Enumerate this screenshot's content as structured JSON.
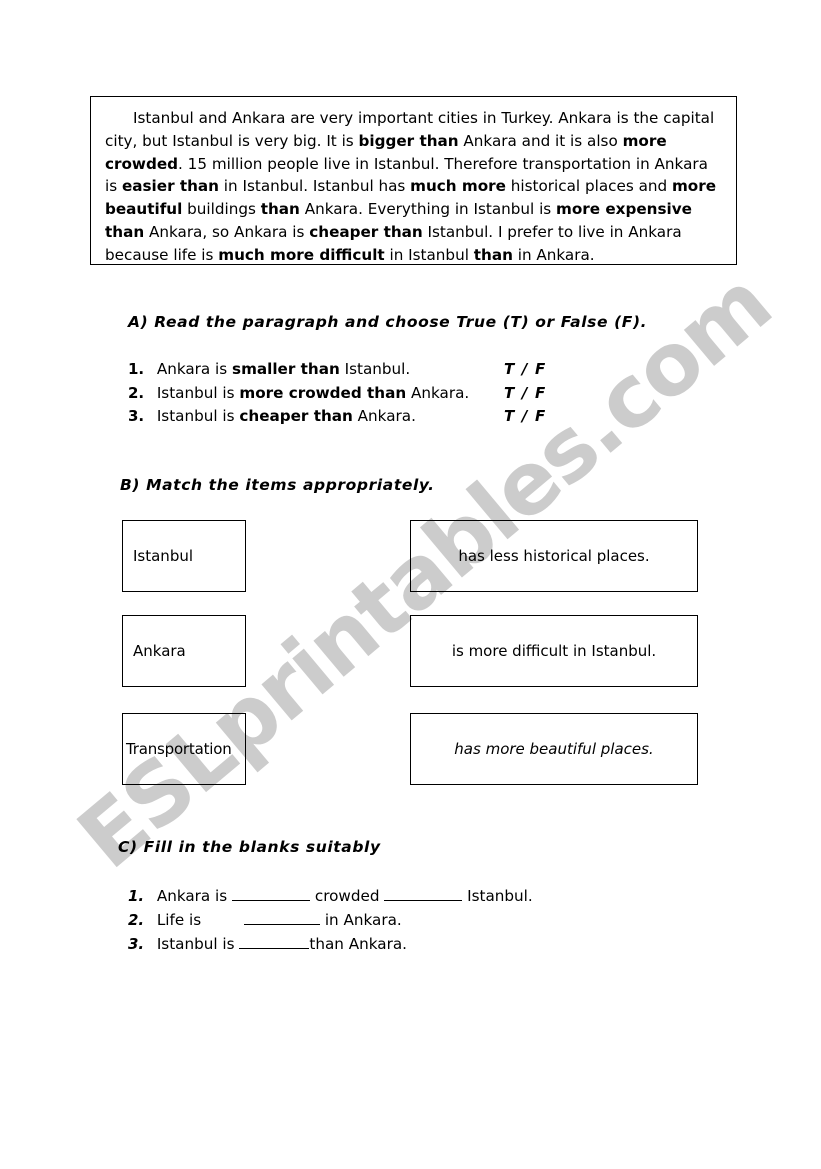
{
  "watermark": {
    "text": "ESLprintables.com",
    "color": "#cccccc"
  },
  "paragraph": {
    "segments": [
      {
        "text": "Istanbul and Ankara are very important cities in Turkey. Ankara is the capital city, but Istanbul is very big. It is ",
        "bold": false
      },
      {
        "text": "bigger than",
        "bold": true
      },
      {
        "text": " Ankara and it is also ",
        "bold": false
      },
      {
        "text": "more crowded",
        "bold": true
      },
      {
        "text": ".  15 million people live in Istanbul. Therefore transportation in Ankara is ",
        "bold": false
      },
      {
        "text": "easier than",
        "bold": true
      },
      {
        "text": " in Istanbul. Istanbul has ",
        "bold": false
      },
      {
        "text": "much  more",
        "bold": true
      },
      {
        "text": " historical places and ",
        "bold": false
      },
      {
        "text": "more beautiful",
        "bold": true
      },
      {
        "text": " buildings ",
        "bold": false
      },
      {
        "text": "than",
        "bold": true
      },
      {
        "text": " Ankara. Everything in Istanbul is ",
        "bold": false
      },
      {
        "text": "more expensive than",
        "bold": true
      },
      {
        "text": " Ankara, so Ankara is ",
        "bold": false
      },
      {
        "text": "cheaper than",
        "bold": true
      },
      {
        "text": " Istanbul. I prefer to live in Ankara because life is ",
        "bold": false
      },
      {
        "text": "much  more difficult",
        "bold": true
      },
      {
        "text": " in Istanbul ",
        "bold": false
      },
      {
        "text": "than",
        "bold": true
      },
      {
        "text": " in Ankara.",
        "bold": false
      }
    ]
  },
  "section_a": {
    "heading": "A) Read the paragraph and choose True (T) or False (F).",
    "choice_label": "T / F",
    "items": [
      {
        "number": "1.",
        "choice": "T / F",
        "segments": [
          {
            "text": " Ankara is ",
            "bold": false
          },
          {
            "text": "smaller than",
            "bold": true
          },
          {
            "text": " Istanbul.",
            "bold": false
          }
        ]
      },
      {
        "number": "2.",
        "choice": "T / F",
        "segments": [
          {
            "text": " Istanbul is ",
            "bold": false
          },
          {
            "text": "more crowded than",
            "bold": true
          },
          {
            "text": " Ankara.",
            "bold": false
          }
        ]
      },
      {
        "number": "3.",
        "choice": "T / F",
        "segments": [
          {
            "text": " Istanbul is ",
            "bold": false
          },
          {
            "text": "cheaper than",
            "bold": true
          },
          {
            "text": "  Ankara.",
            "bold": false
          }
        ]
      }
    ]
  },
  "section_b": {
    "heading": "B) Match the items appropriately.",
    "left_items": [
      {
        "label": "Istanbul"
      },
      {
        "label": "Ankara"
      },
      {
        "label": "Transportation"
      }
    ],
    "right_items": [
      {
        "label": "has less historical places.",
        "italic": false
      },
      {
        "label": "is more difficult in Istanbul.",
        "italic": false
      },
      {
        "label": "has more beautiful places.",
        "italic": true
      }
    ]
  },
  "section_c": {
    "heading": "C) Fill in the blanks suitably",
    "items": [
      {
        "number": "1.",
        "part1": " Ankara is ",
        "part2": " crowded ",
        "part3": " Istanbul."
      },
      {
        "number": "2.",
        "part1": " Life is ",
        "part2": " in Ankara.",
        "part3": ""
      },
      {
        "number": "3.",
        "part1": " Istanbul is ",
        "part2": "than Ankara.",
        "part3": ""
      }
    ]
  }
}
